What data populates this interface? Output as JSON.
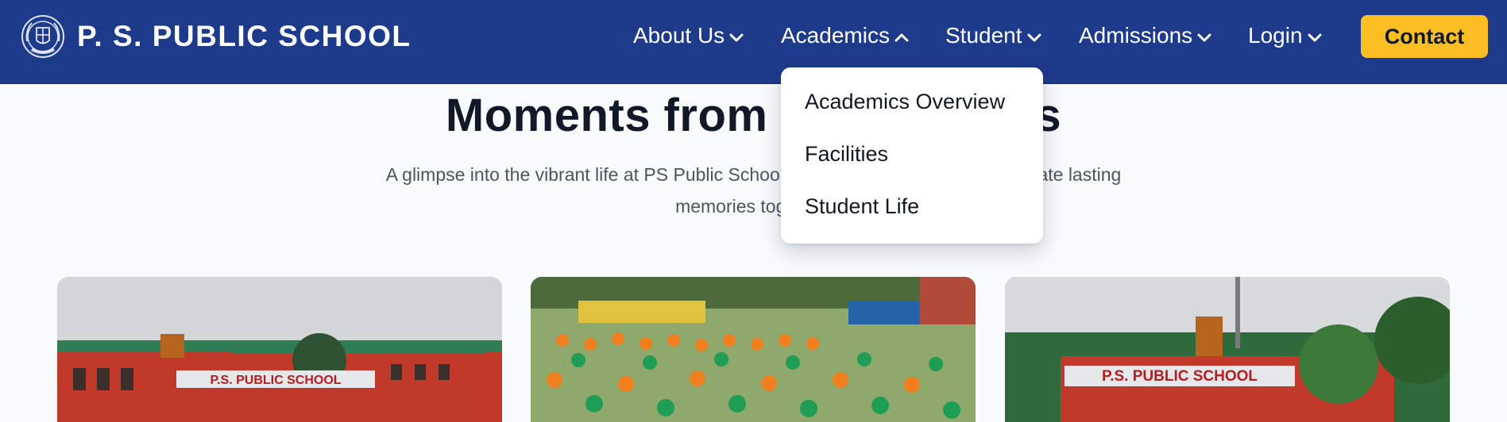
{
  "header": {
    "school_name": "P. S. PUBLIC SCHOOL",
    "logo_icon": "school-crest-icon",
    "nav": [
      {
        "label": "About Us",
        "chevron": "chevron-down-icon"
      },
      {
        "label": "Academics",
        "chevron": "chevron-up-icon"
      },
      {
        "label": "Student",
        "chevron": "chevron-down-icon"
      },
      {
        "label": "Admissions",
        "chevron": "chevron-down-icon"
      },
      {
        "label": "Login",
        "chevron": "chevron-down-icon"
      }
    ],
    "contact_label": "Contact"
  },
  "academics_menu": {
    "items": [
      "Academics Overview",
      "Facilities",
      "Student Life"
    ]
  },
  "gallery": {
    "title": "Moments from Our Campus",
    "subtitle": "A glimpse into the vibrant life at PS Public School, where we learn, grow, and create lasting memories together.",
    "photos": [
      {
        "sign_text": "P.S. PUBLIC SCHOOL"
      },
      {
        "sign_text": ""
      },
      {
        "sign_text": "P.S. PUBLIC SCHOOL"
      }
    ]
  },
  "colors": {
    "header_bg": "#1e3a8a",
    "accent": "#fbbf24",
    "page_bg": "#f8fafc",
    "title_text": "#111827",
    "body_text": "#4b5563"
  }
}
